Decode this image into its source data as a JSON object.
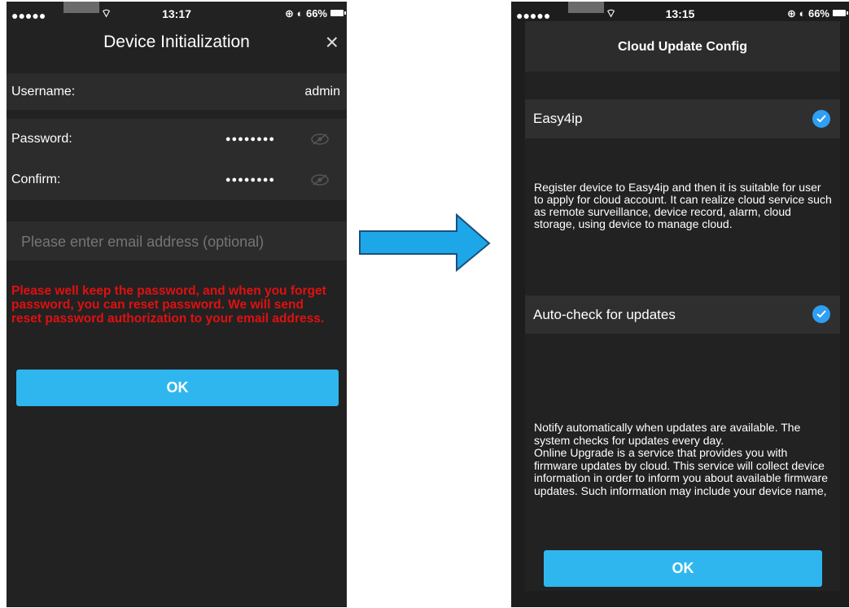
{
  "left": {
    "status": {
      "signal": "●●●●●",
      "time": "13:17",
      "right": "⊕ ◐ 66%"
    },
    "title": "Device Initialization",
    "close_icon": "×",
    "username_label": "Username:",
    "username_value": "admin",
    "password_label": "Password:",
    "password_value": "●●●●●●●●",
    "confirm_label": "Confirm:",
    "confirm_value": "●●●●●●●●",
    "email_placeholder": "Please enter email address (optional)",
    "warning": "Please well keep the password, and when you forget password, you can reset password. We will send reset password authorization to your email address.",
    "ok_label": "OK",
    "colors": {
      "warning": "#e01010",
      "button": "#2fb6ef",
      "background": "#222222"
    }
  },
  "right": {
    "status": {
      "signal": "●●●●●",
      "time": "13:15",
      "right": "⊕ ◐ 66%"
    },
    "title": "Cloud Update Config",
    "easy4ip_label": "Easy4ip",
    "easy4ip_desc": "Register device to Easy4ip and then it is suitable for user to apply for cloud account. It can realize cloud service such as remote surveillance, device record, alarm, cloud storage, using device to manage cloud.",
    "autocheck_label": "Auto-check for updates",
    "autocheck_desc_1": "Notify automatically when updates are available. The system checks for updates every day.",
    "autocheck_desc_2": "Online Upgrade is a service that provides you with firmware updates by cloud. This service will collect device information in order to inform you about available firmware updates. Such information may include your device name,",
    "ok_label": "OK",
    "colors": {
      "check": "#2f9ef3",
      "button": "#2fb6ef"
    }
  },
  "arrow": {
    "color": "#1ea7e8"
  }
}
